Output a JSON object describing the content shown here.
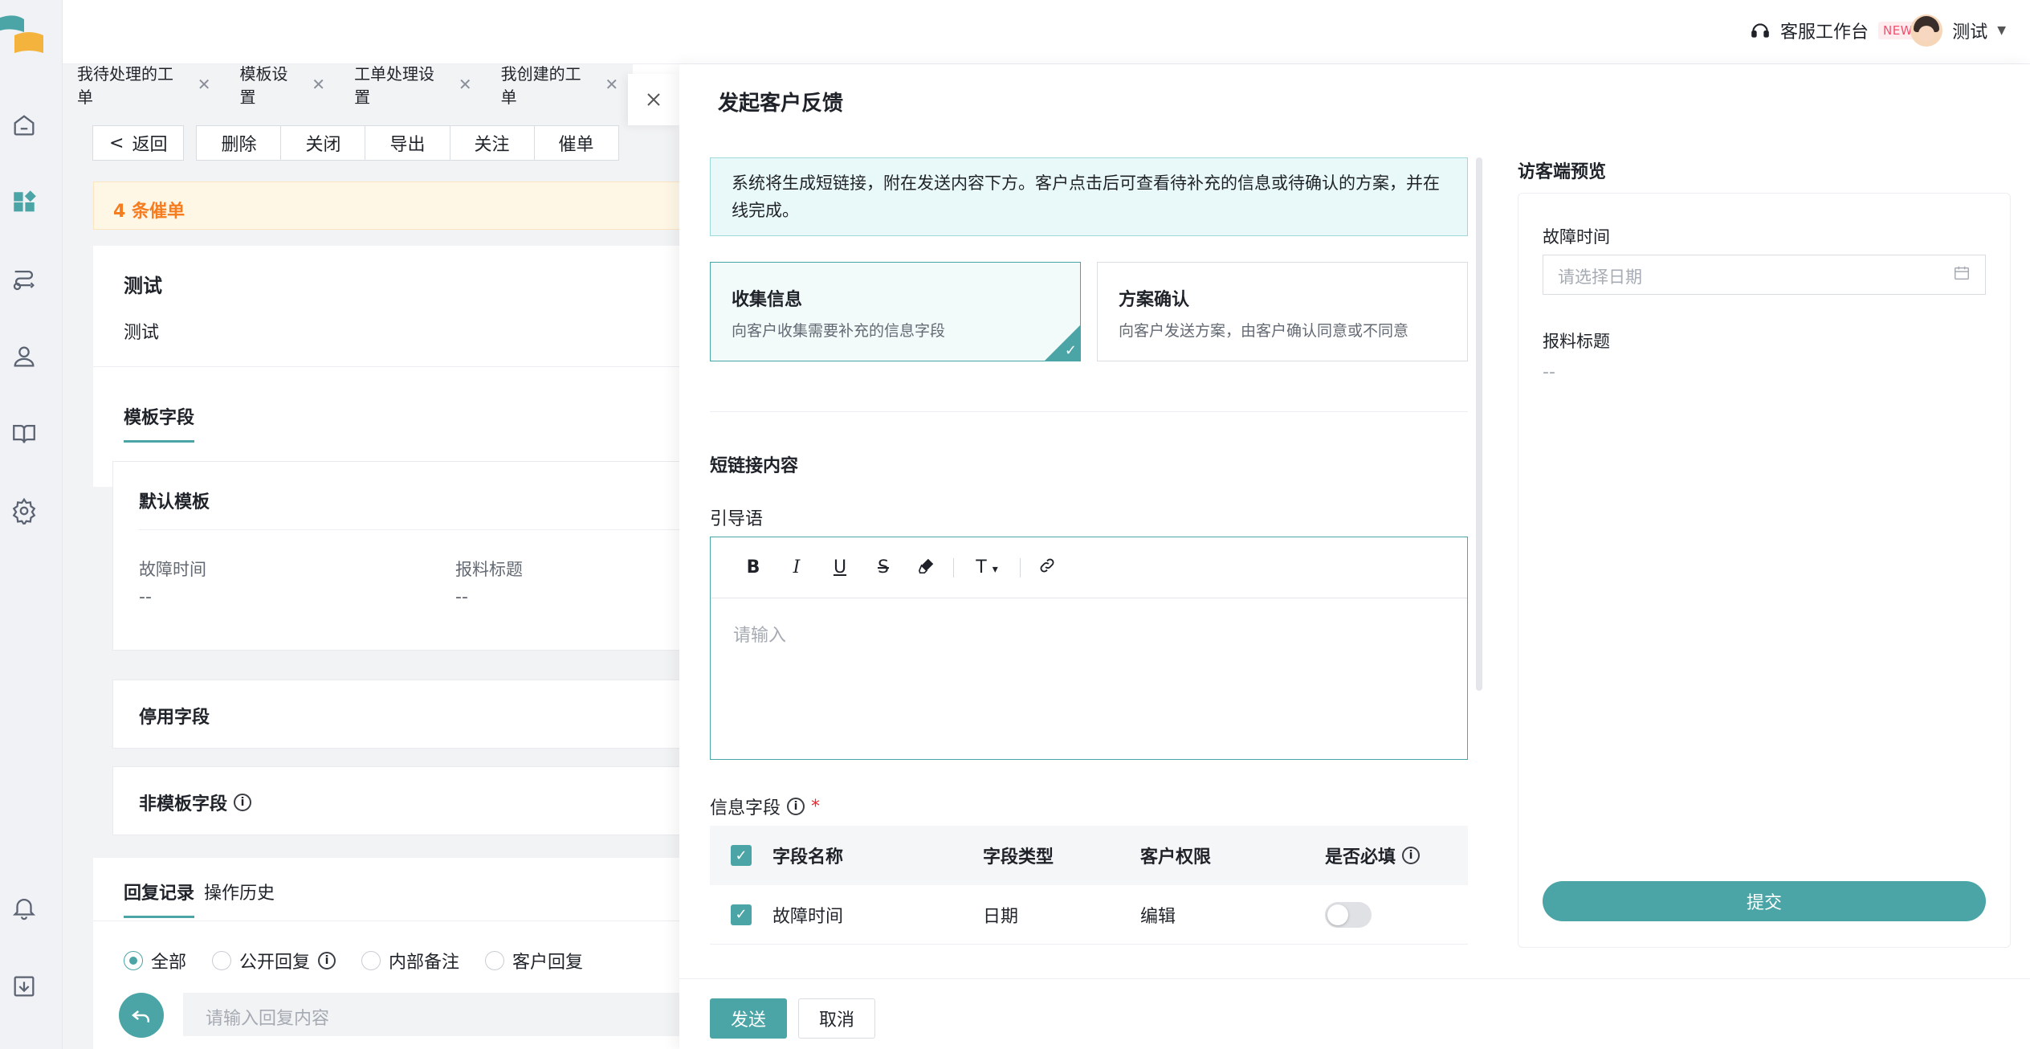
{
  "topbar": {
    "workspace": "客服工作台",
    "new_badge": "NEW",
    "user": "测试"
  },
  "tabs": [
    {
      "label": "我待处理的工单"
    },
    {
      "label": "模板设置"
    },
    {
      "label": "工单处理设置"
    },
    {
      "label": "我创建的工单"
    }
  ],
  "actions": {
    "back": "返回",
    "delete": "删除",
    "close": "关闭",
    "export": "导出",
    "follow": "关注",
    "urge": "催单"
  },
  "alert": "4 条催单",
  "ticket": {
    "title": "测试",
    "desc": "测试",
    "tab": "模板字段"
  },
  "default_template": {
    "title": "默认模板",
    "fields": [
      {
        "label": "故障时间",
        "value": "--"
      },
      {
        "label": "报料标题",
        "value": "--"
      }
    ]
  },
  "disabled_fields": "停用字段",
  "non_template_fields": "非模板字段",
  "records": {
    "tab_reply": "回复记录",
    "tab_history": "操作历史",
    "filters": [
      "全部",
      "公开回复",
      "内部备注",
      "客户回复"
    ],
    "reply_placeholder": "请输入回复内容"
  },
  "drawer": {
    "title": "发起客户反馈",
    "notice": "系统将生成短链接，附在发送内容下方。客户点击后可查看待补充的信息或待确认的方案，并在线完成。",
    "options": [
      {
        "title": "收集信息",
        "desc": "向客户收集需要补充的信息字段"
      },
      {
        "title": "方案确认",
        "desc": "向客户发送方案，由客户确认同意或不同意"
      }
    ],
    "section": "短链接内容",
    "guide_label": "引导语",
    "editor_placeholder": "请输入",
    "info_label": "信息字段",
    "required_mark": "*",
    "table": {
      "headers": [
        "字段名称",
        "字段类型",
        "客户权限",
        "是否必填"
      ],
      "rows": [
        {
          "name": "故障时间",
          "type": "日期",
          "perm": "编辑"
        }
      ]
    },
    "preview": {
      "title": "访客端预览",
      "field1": "故障时间",
      "date_placeholder": "请选择日期",
      "field2": "报料标题",
      "field2_value": "--",
      "submit": "提交"
    },
    "send": "发送",
    "cancel": "取消"
  },
  "colors": {
    "accent": "#4ba5a6",
    "alert_text": "#f57c1f"
  }
}
